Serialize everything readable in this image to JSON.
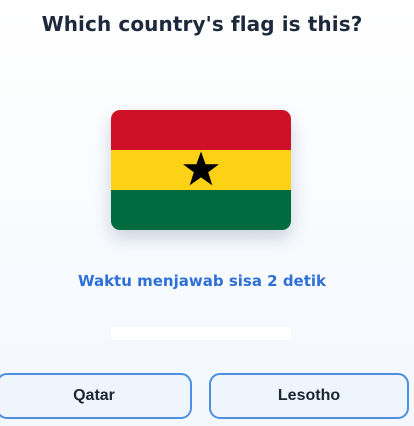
{
  "question": "Which country's flag is this?",
  "flag": {
    "colors": {
      "red": "#ce1126",
      "yellow": "#fcd116",
      "green": "#006b3f",
      "star": "#000000"
    }
  },
  "timer": {
    "text": "Waktu menjawab sisa 2 detik",
    "color": "#2f6fd8"
  },
  "progress": {
    "value": 1.0
  },
  "options": [
    {
      "label": "Qatar"
    },
    {
      "label": "Lesotho"
    }
  ],
  "colors": {
    "accent": "#4d8fe2",
    "button_bg": "#eef5fd",
    "question_text": "#1e2a3b"
  }
}
